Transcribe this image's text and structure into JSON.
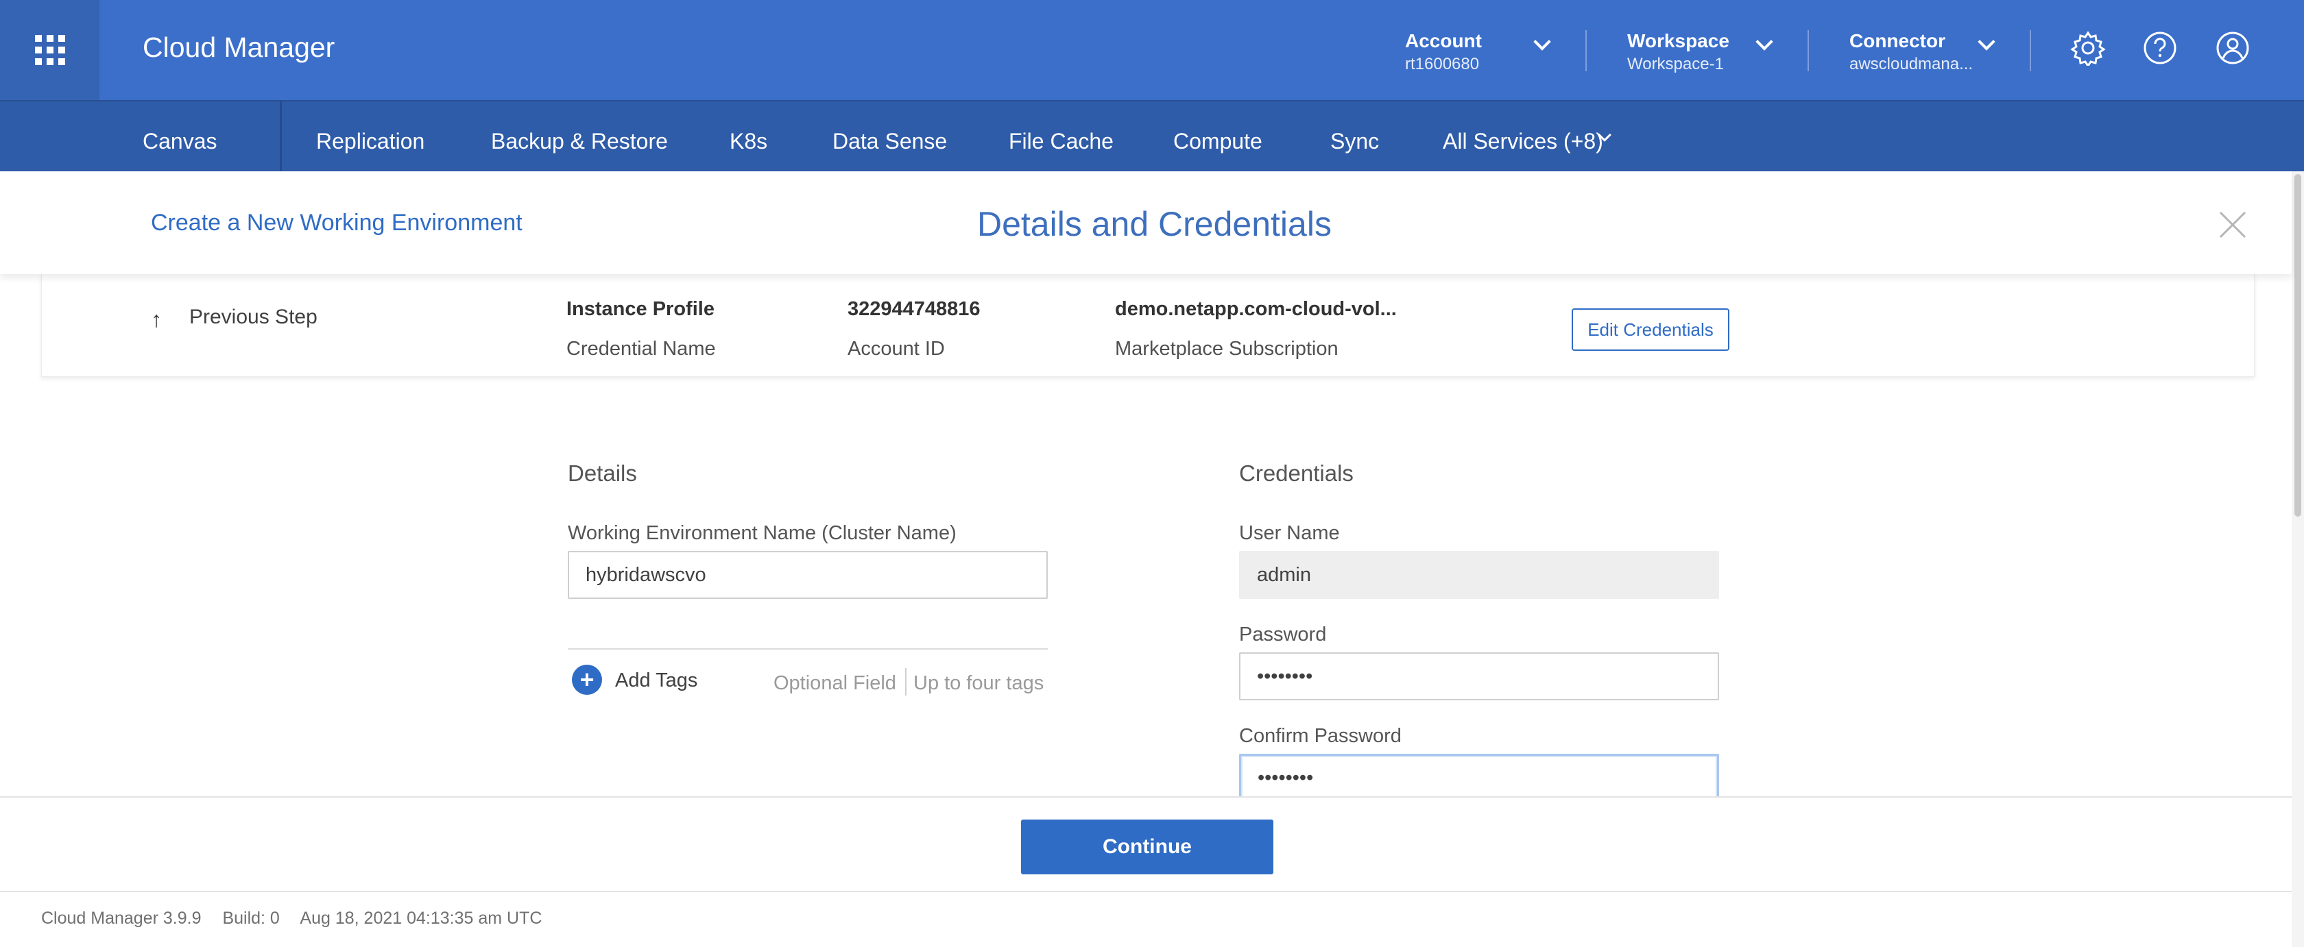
{
  "header": {
    "app_title": "Cloud Manager",
    "account": {
      "label": "Account",
      "value": "rt1600680"
    },
    "workspace": {
      "label": "Workspace",
      "value": "Workspace-1"
    },
    "connector": {
      "label": "Connector",
      "value": "awscloudmana..."
    },
    "icons": [
      "apps-grid-icon",
      "settings-gear-icon",
      "help-icon",
      "user-profile-icon"
    ]
  },
  "nav": {
    "items": [
      "Canvas",
      "Replication",
      "Backup & Restore",
      "K8s",
      "Data Sense",
      "File Cache",
      "Compute",
      "Sync",
      "All Services (+8)"
    ]
  },
  "subheader": {
    "create_link": "Create a New Working Environment",
    "title": "Details and Credentials"
  },
  "credentials_strip": {
    "previous_step": "Previous Step",
    "instance_profile": {
      "value": "Instance Profile",
      "label": "Credential Name"
    },
    "account_id": {
      "value": "322944748816",
      "label": "Account ID"
    },
    "marketplace": {
      "value": "demo.netapp.com-cloud-vol...",
      "label": "Marketplace Subscription"
    },
    "edit_button": "Edit Credentials"
  },
  "details": {
    "section_title": "Details",
    "cluster_name_label": "Working Environment Name (Cluster Name)",
    "cluster_name_value": "hybridawscvo",
    "add_tags": "Add Tags",
    "optional_field": "Optional Field",
    "up_to_four": "Up to four tags"
  },
  "credentials": {
    "section_title": "Credentials",
    "username_label": "User Name",
    "username_value": "admin",
    "password_label": "Password",
    "password_value": "••••••••",
    "confirm_label": "Confirm Password",
    "confirm_value": "••••••••"
  },
  "actions": {
    "continue": "Continue"
  },
  "status": {
    "version": "Cloud Manager 3.9.9",
    "build": "Build: 0",
    "timestamp": "Aug 18, 2021 04:13:35 am UTC"
  },
  "colors": {
    "header_bg": "#3b6fca",
    "nav_bg": "#2f5ca8",
    "accent": "#2f6cc5"
  }
}
